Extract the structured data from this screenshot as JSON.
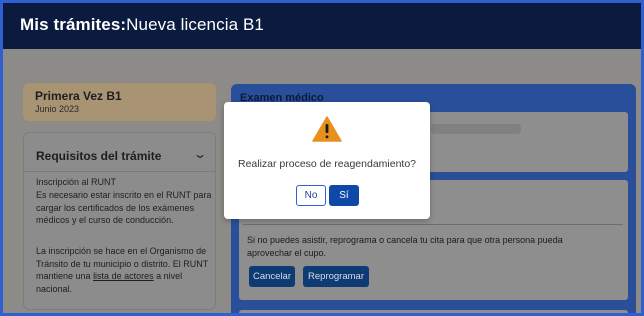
{
  "header": {
    "title_prefix": "Mis trámites:",
    "title_main": "Nueva licencia B1"
  },
  "license_card": {
    "name": "Primera Vez B1",
    "date": "Junio 2023"
  },
  "requirements": {
    "heading": "Requisitos del trámite",
    "subheading": "Inscripción al RUNT",
    "paragraph1": "Es necesario estar inscrito en el RUNT para cargar los certificados de los exámenes médicos y el curso de conducción.",
    "paragraph2_before": "La inscripción se hace en el Organismo de Tránsito de tu municipio o distrito. El RUNT mantiene una",
    "paragraph2_link": "lista de actores",
    "paragraph2_after": "a nivel nacional."
  },
  "panel": {
    "title": "Examen médico",
    "info": "Si no puedes asistir, reprograma o cancela tu cita para que otra persona pueda aprovechar el cupo.",
    "cancel_label": "Cancelar",
    "reschedule_label": "Reprogramar"
  },
  "modal": {
    "message": "Realizar proceso de reagendamiento?",
    "no_label": "No",
    "yes_label": "Sí"
  },
  "colors": {
    "header_bg": "#0b1a3f",
    "primary": "#0e49a8",
    "warning": "#e8901c"
  },
  "icons": {
    "modal_icon": "warning-icon",
    "collapse_icon": "chevron-down-icon"
  }
}
